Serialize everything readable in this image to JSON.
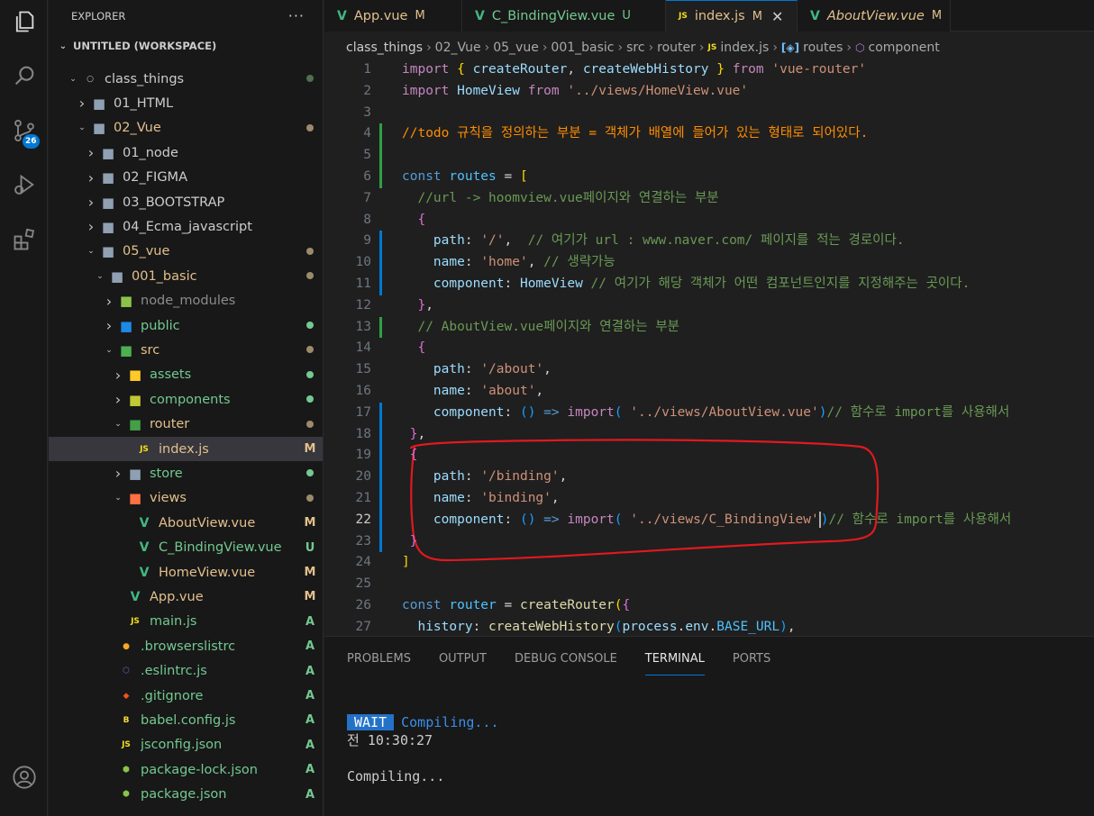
{
  "explorer": {
    "title": "EXPLORER",
    "more": "···",
    "workspace": "UNTITLED (WORKSPACE)",
    "tree": [
      {
        "label": "class_things",
        "depth": 1,
        "kind": "root",
        "open": true,
        "status": "dot",
        "color": "#cccccc"
      },
      {
        "label": "01_HTML",
        "depth": 2,
        "kind": "folder",
        "open": false,
        "status": "",
        "color": "#cccccc"
      },
      {
        "label": "02_Vue",
        "depth": 2,
        "kind": "folder",
        "open": true,
        "status": "dot-orange",
        "color": "#e2c08d"
      },
      {
        "label": "01_node",
        "depth": 3,
        "kind": "folder",
        "open": false,
        "status": "",
        "color": "#cccccc"
      },
      {
        "label": "02_FIGMA",
        "depth": 3,
        "kind": "folder",
        "open": false,
        "status": "",
        "color": "#cccccc"
      },
      {
        "label": "03_BOOTSTRAP",
        "depth": 3,
        "kind": "folder",
        "open": false,
        "status": "",
        "color": "#cccccc"
      },
      {
        "label": "04_Ecma_javascript",
        "depth": 3,
        "kind": "folder",
        "open": false,
        "status": "",
        "color": "#cccccc"
      },
      {
        "label": "05_vue",
        "depth": 3,
        "kind": "folder",
        "open": true,
        "status": "dot-orange",
        "color": "#e2c08d"
      },
      {
        "label": "001_basic",
        "depth": 4,
        "kind": "folder",
        "open": true,
        "status": "dot-orange",
        "color": "#e2c08d"
      },
      {
        "label": "node_modules",
        "depth": 5,
        "kind": "folder-node",
        "open": false,
        "status": "",
        "color": "#8c8c8c"
      },
      {
        "label": "public",
        "depth": 5,
        "kind": "folder-public",
        "open": false,
        "status": "dot-green",
        "color": "#73c991"
      },
      {
        "label": "src",
        "depth": 5,
        "kind": "folder-src",
        "open": true,
        "status": "dot-orange",
        "color": "#e2c08d"
      },
      {
        "label": "assets",
        "depth": 6,
        "kind": "folder-assets",
        "open": false,
        "status": "dot-green",
        "color": "#73c991"
      },
      {
        "label": "components",
        "depth": 6,
        "kind": "folder-components",
        "open": false,
        "status": "dot-green",
        "color": "#73c991"
      },
      {
        "label": "router",
        "depth": 6,
        "kind": "folder-router",
        "open": true,
        "status": "dot-orange",
        "color": "#e2c08d"
      },
      {
        "label": "index.js",
        "depth": 7,
        "kind": "js",
        "open": false,
        "status": "M",
        "color": "#e2c08d",
        "selected": true
      },
      {
        "label": "store",
        "depth": 6,
        "kind": "folder",
        "open": false,
        "status": "dot-green",
        "color": "#73c991"
      },
      {
        "label": "views",
        "depth": 6,
        "kind": "folder-views",
        "open": true,
        "status": "dot-orange",
        "color": "#e2c08d"
      },
      {
        "label": "AboutView.vue",
        "depth": 7,
        "kind": "vue",
        "open": false,
        "status": "M",
        "color": "#e2c08d"
      },
      {
        "label": "C_BindingView.vue",
        "depth": 7,
        "kind": "vue",
        "open": false,
        "status": "U",
        "color": "#73c991"
      },
      {
        "label": "HomeView.vue",
        "depth": 7,
        "kind": "vue",
        "open": false,
        "status": "M",
        "color": "#e2c08d"
      },
      {
        "label": "App.vue",
        "depth": 6,
        "kind": "vue",
        "open": false,
        "status": "M",
        "color": "#e2c08d"
      },
      {
        "label": "main.js",
        "depth": 6,
        "kind": "js",
        "open": false,
        "status": "A",
        "color": "#73c991"
      },
      {
        "label": ".browserslistrc",
        "depth": 5,
        "kind": "browserslist",
        "open": false,
        "status": "A",
        "color": "#73c991"
      },
      {
        "label": ".eslintrc.js",
        "depth": 5,
        "kind": "eslint",
        "open": false,
        "status": "A",
        "color": "#73c991"
      },
      {
        "label": ".gitignore",
        "depth": 5,
        "kind": "git",
        "open": false,
        "status": "A",
        "color": "#73c991"
      },
      {
        "label": "babel.config.js",
        "depth": 5,
        "kind": "babel",
        "open": false,
        "status": "A",
        "color": "#73c991"
      },
      {
        "label": "jsconfig.json",
        "depth": 5,
        "kind": "jsconfig",
        "open": false,
        "status": "A",
        "color": "#73c991"
      },
      {
        "label": "package-lock.json",
        "depth": 5,
        "kind": "nodejson",
        "open": false,
        "status": "A",
        "color": "#73c991"
      },
      {
        "label": "package.json",
        "depth": 5,
        "kind": "nodejson",
        "open": false,
        "status": "A",
        "color": "#73c991"
      }
    ]
  },
  "activity": {
    "scm_badge": "26"
  },
  "tabs": [
    {
      "label": "App.vue",
      "status": "M",
      "icon": "vue",
      "status_color": "#e2c08d",
      "active": false,
      "italic": false
    },
    {
      "label": "C_BindingView.vue",
      "status": "U",
      "icon": "vue",
      "status_color": "#73c991",
      "active": false,
      "italic": false
    },
    {
      "label": "index.js",
      "status": "M",
      "icon": "js",
      "status_color": "#e2c08d",
      "active": true,
      "italic": false,
      "close": "✕"
    },
    {
      "label": "AboutView.vue",
      "status": "M",
      "icon": "vue",
      "status_color": "#e2c08d",
      "active": false,
      "italic": true
    }
  ],
  "breadcrumb": [
    "class_things",
    "02_Vue",
    "05_vue",
    "001_basic",
    "src",
    "router",
    "index.js",
    "routes",
    "component"
  ],
  "editor": {
    "lines": [
      {
        "n": "1",
        "tokens": [
          [
            "k",
            "import "
          ],
          [
            "p1",
            "{ "
          ],
          [
            "v",
            "createRouter"
          ],
          [
            "w",
            ", "
          ],
          [
            "v",
            "createWebHistory"
          ],
          [
            "p1",
            " } "
          ],
          [
            "k",
            "from "
          ],
          [
            "s",
            "'vue-router'"
          ]
        ]
      },
      {
        "n": "2",
        "tokens": [
          [
            "k",
            "import "
          ],
          [
            "v",
            "HomeView "
          ],
          [
            "k",
            "from "
          ],
          [
            "s",
            "'../views/HomeView.vue'"
          ]
        ]
      },
      {
        "n": "3",
        "tokens": []
      },
      {
        "n": "4",
        "tokens": [
          [
            "todo",
            "//todo 규칙을 정의하는 부분 = 객체가 배열에 들어가 있는 형태로 되어있다."
          ]
        ]
      },
      {
        "n": "5",
        "tokens": []
      },
      {
        "n": "6",
        "tokens": [
          [
            "kw",
            "const "
          ],
          [
            "cv",
            "routes "
          ],
          [
            "w",
            "= "
          ],
          [
            "p1",
            "["
          ]
        ]
      },
      {
        "n": "7",
        "tokens": [
          [
            "c",
            "  //url -> hoomview.vue페이지와 연결하는 부분"
          ]
        ]
      },
      {
        "n": "8",
        "tokens": [
          [
            "p2",
            "  {"
          ]
        ]
      },
      {
        "n": "9",
        "tokens": [
          [
            "v",
            "    path"
          ],
          [
            "w",
            ": "
          ],
          [
            "s",
            "'/'"
          ],
          [
            "w",
            ",  "
          ],
          [
            "c",
            "// 여기가 url : www.naver.com/ 페이지를 적는 경로이다."
          ]
        ]
      },
      {
        "n": "10",
        "tokens": [
          [
            "v",
            "    name"
          ],
          [
            "w",
            ": "
          ],
          [
            "s",
            "'home'"
          ],
          [
            "w",
            ", "
          ],
          [
            "c",
            "// 생략가능"
          ]
        ]
      },
      {
        "n": "11",
        "tokens": [
          [
            "v",
            "    component"
          ],
          [
            "w",
            ": "
          ],
          [
            "v",
            "HomeView "
          ],
          [
            "c",
            "// 여기가 해당 객체가 어떤 컴포넌트인지를 지정해주는 곳이다."
          ]
        ]
      },
      {
        "n": "12",
        "tokens": [
          [
            "p2",
            "  }"
          ],
          [
            "w",
            ","
          ]
        ]
      },
      {
        "n": "13",
        "tokens": [
          [
            "c",
            "  // AboutView.vue페이지와 연결하는 부분"
          ]
        ]
      },
      {
        "n": "14",
        "tokens": [
          [
            "p2",
            "  {"
          ]
        ]
      },
      {
        "n": "15",
        "tokens": [
          [
            "v",
            "    path"
          ],
          [
            "w",
            ": "
          ],
          [
            "s",
            "'/about'"
          ],
          [
            "w",
            ","
          ]
        ]
      },
      {
        "n": "16",
        "tokens": [
          [
            "v",
            "    name"
          ],
          [
            "w",
            ": "
          ],
          [
            "s",
            "'about'"
          ],
          [
            "w",
            ","
          ]
        ]
      },
      {
        "n": "17",
        "tokens": [
          [
            "v",
            "    component"
          ],
          [
            "w",
            ": "
          ],
          [
            "p3",
            "() "
          ],
          [
            "kw",
            "=> "
          ],
          [
            "k",
            "import"
          ],
          [
            "p3",
            "( "
          ],
          [
            "s",
            "'../views/AboutView.vue'"
          ],
          [
            "p3",
            ")"
          ],
          [
            "c",
            "// 함수로 import를 사용해서"
          ]
        ]
      },
      {
        "n": "18",
        "tokens": [
          [
            "p2",
            " }"
          ],
          [
            "w",
            ","
          ]
        ]
      },
      {
        "n": "19",
        "tokens": [
          [
            "p2",
            " {"
          ]
        ]
      },
      {
        "n": "20",
        "tokens": [
          [
            "v",
            "    path"
          ],
          [
            "w",
            ": "
          ],
          [
            "s",
            "'/binding'"
          ],
          [
            "w",
            ","
          ]
        ]
      },
      {
        "n": "21",
        "tokens": [
          [
            "v",
            "    name"
          ],
          [
            "w",
            ": "
          ],
          [
            "s",
            "'binding'"
          ],
          [
            "w",
            ","
          ]
        ]
      },
      {
        "n": "22",
        "tokens": [
          [
            "v",
            "    component"
          ],
          [
            "w",
            ": "
          ],
          [
            "p3",
            "() "
          ],
          [
            "kw",
            "=> "
          ],
          [
            "k",
            "import"
          ],
          [
            "p3",
            "( "
          ],
          [
            "s",
            "'../views/C_BindingView'"
          ],
          [
            "cursor",
            ""
          ],
          [
            "p3",
            ")"
          ],
          [
            "c",
            "// 함수로 import를 사용해서"
          ]
        ]
      },
      {
        "n": "23",
        "tokens": [
          [
            "p2",
            " }"
          ]
        ]
      },
      {
        "n": "24",
        "tokens": [
          [
            "p1",
            "]"
          ]
        ]
      },
      {
        "n": "25",
        "tokens": []
      },
      {
        "n": "26",
        "tokens": [
          [
            "kw",
            "const "
          ],
          [
            "cv",
            "router "
          ],
          [
            "w",
            "= "
          ],
          [
            "f",
            "createRouter"
          ],
          [
            "p1",
            "("
          ],
          [
            "p2",
            "{"
          ]
        ]
      },
      {
        "n": "27",
        "tokens": [
          [
            "v",
            "  history"
          ],
          [
            "w",
            ": "
          ],
          [
            "f",
            "createWebHistory"
          ],
          [
            "p3",
            "("
          ],
          [
            "v",
            "process"
          ],
          [
            "w",
            "."
          ],
          [
            "v",
            "env"
          ],
          [
            "w",
            "."
          ],
          [
            "cv",
            "BASE_URL"
          ],
          [
            "p3",
            ")"
          ],
          [
            "w",
            ","
          ]
        ]
      }
    ],
    "current_line": "22",
    "annotation_color": "#e0191f"
  },
  "panel": {
    "tabs": [
      "PROBLEMS",
      "OUTPUT",
      "DEBUG CONSOLE",
      "TERMINAL",
      "PORTS"
    ],
    "active_tab": "TERMINAL",
    "terminal": {
      "badge": "WAIT",
      "status": "Compiling...",
      "time": "전 10:30:27",
      "last": "Compiling..."
    }
  }
}
